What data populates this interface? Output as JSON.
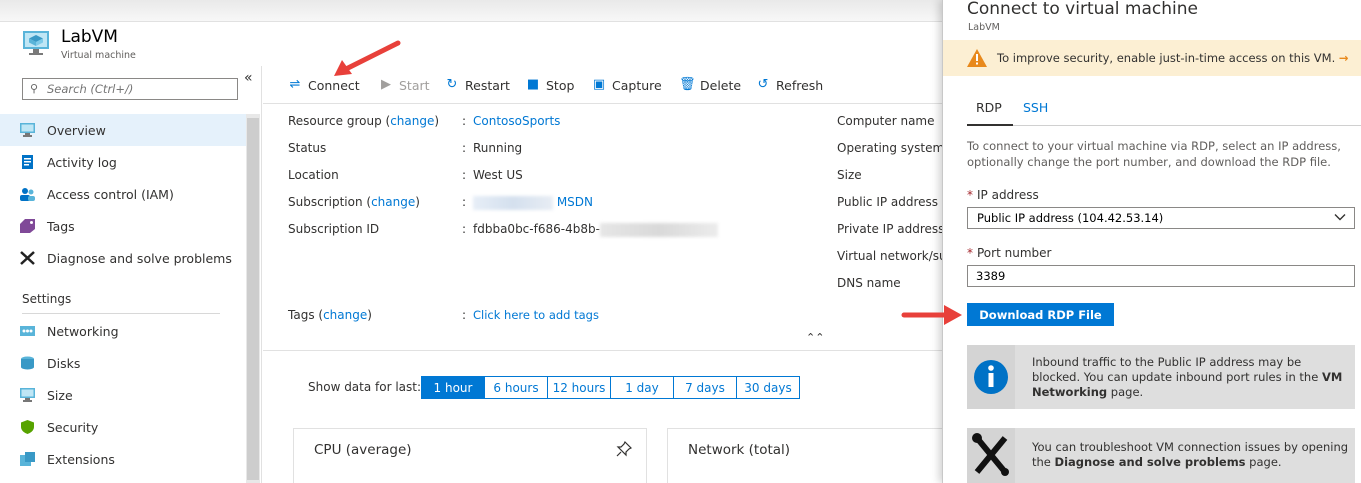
{
  "resource": {
    "title": "LabVM",
    "subtitle": "Virtual machine"
  },
  "sidebar": {
    "search_placeholder": "Search (Ctrl+/)",
    "collapse_glyph": "«",
    "items": [
      {
        "label": "Overview",
        "icon": "overview-icon",
        "active": true
      },
      {
        "label": "Activity log",
        "icon": "activity-log-icon"
      },
      {
        "label": "Access control (IAM)",
        "icon": "iam-icon"
      },
      {
        "label": "Tags",
        "icon": "tag-icon"
      },
      {
        "label": "Diagnose and solve problems",
        "icon": "wrench-icon"
      }
    ],
    "section_label": "Settings",
    "settings_items": [
      {
        "label": "Networking",
        "icon": "networking-icon"
      },
      {
        "label": "Disks",
        "icon": "disks-icon"
      },
      {
        "label": "Size",
        "icon": "size-icon"
      },
      {
        "label": "Security",
        "icon": "shield-icon"
      },
      {
        "label": "Extensions",
        "icon": "extensions-icon"
      }
    ]
  },
  "toolbar": {
    "connect": "Connect",
    "start": "Start",
    "restart": "Restart",
    "stop": "Stop",
    "capture": "Capture",
    "delete": "Delete",
    "refresh": "Refresh"
  },
  "essentials": {
    "change": "change",
    "resource_group_label": "Resource group",
    "resource_group_value": "ContosoSports",
    "status_label": "Status",
    "status_value": "Running",
    "location_label": "Location",
    "location_value": "West US",
    "subscription_label": "Subscription",
    "subscription_value_suffix": "MSDN",
    "subscription_id_label": "Subscription ID",
    "subscription_id_value": "fdbba0bc-f686-4b8b-",
    "tags_label": "Tags",
    "tags_value": "Click here to add tags",
    "colon": ":",
    "right_labels": [
      "Computer name",
      "Operating system",
      "Size",
      "Public IP address",
      "Private IP address",
      "Virtual network/su",
      "DNS name"
    ]
  },
  "metrics": {
    "show_label": "Show data for last:",
    "ranges": [
      "1 hour",
      "6 hours",
      "12 hours",
      "1 day",
      "7 days",
      "30 days"
    ],
    "selected": "1 hour",
    "cards": [
      {
        "title": "CPU (average)"
      },
      {
        "title": "Network (total)"
      }
    ]
  },
  "blade": {
    "title": "Connect to virtual machine",
    "subtitle": "LabVM",
    "banner_text": "To improve security, enable just-in-time access on this VM.",
    "banner_arrow": "→",
    "tabs": [
      "RDP",
      "SSH"
    ],
    "active_tab": "RDP",
    "instructions": "To connect to your virtual machine via RDP, select an IP address, optionally change the port number, and download the RDP file.",
    "required_mark": "*",
    "ip_label": "IP address",
    "ip_value": "Public IP address (104.42.53.14)",
    "port_label": "Port number",
    "port_value": "3389",
    "download_button": "Download RDP File",
    "info1_pre": "Inbound traffic to the Public IP address may be blocked. You can update inbound port rules in the ",
    "info1_bold": "VM Networking",
    "info1_post": " page.",
    "info2_pre": "You can troubleshoot VM connection issues by opening the ",
    "info2_bold": "Diagnose and solve problems",
    "info2_post": " page."
  },
  "colors": {
    "accent": "#0078d4",
    "warning_bg": "#fcefd3",
    "annotation_arrow": "#e8403a"
  }
}
